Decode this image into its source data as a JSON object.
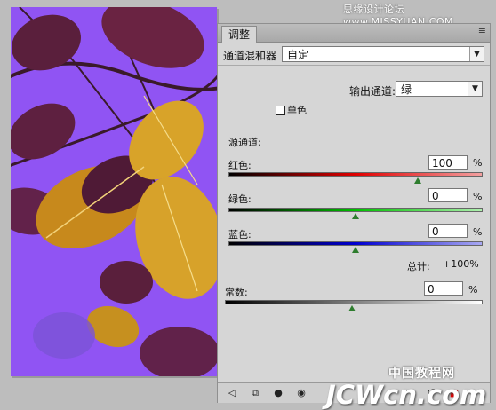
{
  "watermark": {
    "top": "思缘设计论坛 www.MISSYUAN.COM",
    "bottom_cn": "中国教程网",
    "bottom_logo": "JCWcn.com"
  },
  "panel": {
    "tab_label": "调整",
    "menu_icon": "≡",
    "preset_label": "通道混和器",
    "preset_value": "自定",
    "output_label": "输出通道:",
    "output_value": "绿",
    "monochrome_label": "单色",
    "monochrome_checked": false,
    "source_label": "源通道:",
    "red": {
      "label": "红色:",
      "value": "100",
      "unit": "%"
    },
    "green": {
      "label": "绿色:",
      "value": "0",
      "unit": "%"
    },
    "blue": {
      "label": "蓝色:",
      "value": "0",
      "unit": "%"
    },
    "total_label": "总计:",
    "total_value": "+100",
    "total_unit": "%",
    "constant": {
      "label": "常数:",
      "value": "0",
      "unit": "%"
    }
  },
  "bottom_icons": [
    "back-arrow-icon",
    "clip-layer-icon",
    "visibility-mask-icon",
    "eye-icon",
    "reset-icon",
    "delete-icon"
  ]
}
